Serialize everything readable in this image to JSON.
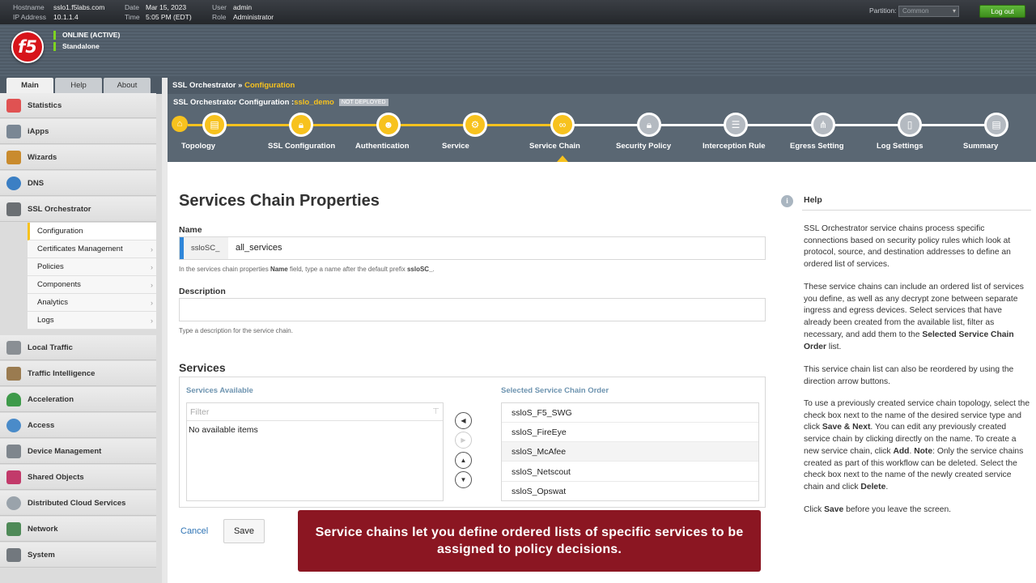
{
  "topbar": {
    "hostname_label": "Hostname",
    "hostname": "sslo1.f5labs.com",
    "ip_label": "IP Address",
    "ip": "10.1.1.4",
    "date_label": "Date",
    "date": "Mar 15, 2023",
    "time_label": "Time",
    "time": "5:05 PM (EDT)",
    "user_label": "User",
    "user": "admin",
    "role_label": "Role",
    "role": "Administrator",
    "partition_label": "Partition:",
    "partition_value": "Common",
    "logout_label": "Log out"
  },
  "header": {
    "logo_text": "f5",
    "status_online": "ONLINE (ACTIVE)",
    "status_mode": "Standalone"
  },
  "sidebar": {
    "tabs": [
      "Main",
      "Help",
      "About"
    ],
    "items": [
      {
        "label": "Statistics",
        "icon": "chart-icon"
      },
      {
        "label": "iApps",
        "icon": "iapps-icon"
      },
      {
        "label": "Wizards",
        "icon": "wizard-icon"
      },
      {
        "label": "DNS",
        "icon": "globe-icon"
      },
      {
        "label": "SSL Orchestrator",
        "icon": "lock-icon"
      },
      {
        "label": "Local Traffic",
        "icon": "local-traffic-icon"
      },
      {
        "label": "Traffic Intelligence",
        "icon": "traffic-intelligence-icon"
      },
      {
        "label": "Acceleration",
        "icon": "gauge-icon"
      },
      {
        "label": "Access",
        "icon": "access-icon"
      },
      {
        "label": "Device Management",
        "icon": "device-icon"
      },
      {
        "label": "Shared Objects",
        "icon": "shared-objects-icon"
      },
      {
        "label": "Distributed Cloud Services",
        "icon": "cloud-icon"
      },
      {
        "label": "Network",
        "icon": "network-icon"
      },
      {
        "label": "System",
        "icon": "system-icon"
      }
    ],
    "subitems": [
      "Configuration",
      "Certificates Management",
      "Policies",
      "Components",
      "Analytics",
      "Logs"
    ]
  },
  "breadcrumb": {
    "root": "SSL Orchestrator",
    "sep": "»",
    "current": "Configuration"
  },
  "config": {
    "title": "SSL Orchestrator Configuration :",
    "name": "sslo_demo",
    "badge": "NOT DEPLOYED"
  },
  "steps": [
    "Topology",
    "SSL Configuration",
    "Authentication",
    "Service",
    "Service Chain",
    "Security Policy",
    "Interception Rule",
    "Egress Setting",
    "Log Settings",
    "Summary"
  ],
  "form": {
    "title": "Services Chain Properties",
    "name_label": "Name",
    "name_prefix": "ssloSC_",
    "name_value": "all_services",
    "name_hint_1": "In the services chain properties ",
    "name_hint_b1": "Name",
    "name_hint_2": " field, type a name after the default prefix ",
    "name_hint_b2": "ssloSC_",
    "name_hint_3": ".",
    "desc_label": "Description",
    "desc_value": "",
    "desc_hint": "Type a description for the service chain.",
    "services_title": "Services",
    "available_title": "Services Available",
    "filter_placeholder": "Filter",
    "no_items": "No available items",
    "selected_title": "Selected Service Chain Order",
    "selected": [
      "ssloS_F5_SWG",
      "ssloS_FireEye",
      "ssloS_McAfee",
      "ssloS_Netscout",
      "ssloS_Opswat"
    ],
    "cancel": "Cancel",
    "save": "Save"
  },
  "help": {
    "title": "Help",
    "p1": "SSL Orchestrator service chains process specific connections based on security policy rules which look at protocol, source, and destination addresses to define an ordered list of services.",
    "p2a": "These service chains can include an ordered list of services you define, as well as any decrypt zone between separate ingress and egress devices. Select services that have already been created from the available list, filter as necessary, and add them to the ",
    "p2b": "Selected Service Chain Order",
    "p2c": " list.",
    "p3": "This service chain list can also be reordered by using the direction arrow buttons.",
    "p4a": "To use a previously created service chain topology, select the check box next to the name of the desired service type and click ",
    "p4b": "Save & Next",
    "p4c": ". You can edit any previously created service chain by clicking directly on the name. To create a new service chain, click ",
    "p4d": "Add",
    "p4e": ". ",
    "p4f": "Note",
    "p4g": ": Only the service chains created as part of this workflow can be deleted. Select the check box next to the name of the newly created service chain and click ",
    "p4h": "Delete",
    "p4i": ".",
    "p5a": "Click ",
    "p5b": "Save",
    "p5c": " before you leave the screen."
  },
  "caption": "Service chains let you define ordered lists of specific services to be assigned to policy decisions.",
  "colors": {
    "accent": "#f7c21e",
    "header": "#4e5a66",
    "caption_bg": "#8b1622",
    "link": "#2f74b5"
  }
}
